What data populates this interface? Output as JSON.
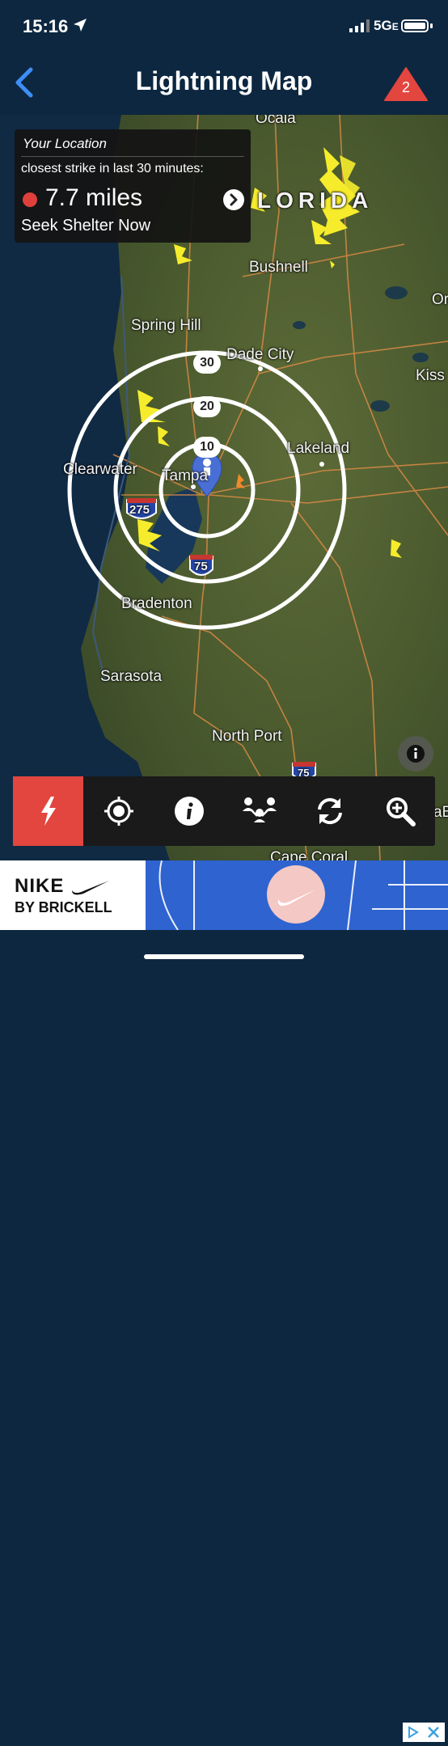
{
  "status_bar": {
    "time": "15:16",
    "network": "5G",
    "network_suffix": "E"
  },
  "nav": {
    "title": "Lightning Map",
    "alert_count": "2"
  },
  "info_box": {
    "heading": "Your Location",
    "subheading": "closest strike in last 30 minutes:",
    "distance": "7.7  miles",
    "advice": "Seek Shelter Now"
  },
  "map": {
    "labels": {
      "ocala": "Ocala",
      "florida": "LORIDA",
      "bushnell": "Bushnell",
      "spring_hill": "Spring Hill",
      "dade_city": "Dade City",
      "kiss": "Kiss",
      "clearwater": "Clearwater",
      "lakeland": "Lakeland",
      "tampa": "Tampa",
      "bradenton": "Bradenton",
      "sarasota": "Sarasota",
      "north_port": "North Port",
      "cape_coral": "Cape Coral",
      "or": "Or",
      "ba": "aB",
      "hwy_275": "275",
      "hwy_75": "75",
      "hwy_75_south": "75"
    },
    "rings": [
      "30",
      "20",
      "10"
    ]
  },
  "toolbar": {
    "items": [
      "lightning-icon",
      "locate-icon",
      "info-icon",
      "share-icon",
      "refresh-icon",
      "zoom-icon"
    ]
  },
  "ad": {
    "brand": "NIKE",
    "sub": "BY BRICKELL"
  },
  "colors": {
    "nav_bg": "#0d2740",
    "accent_red": "#e2463f",
    "strike_yellow": "#f6ec2c"
  }
}
